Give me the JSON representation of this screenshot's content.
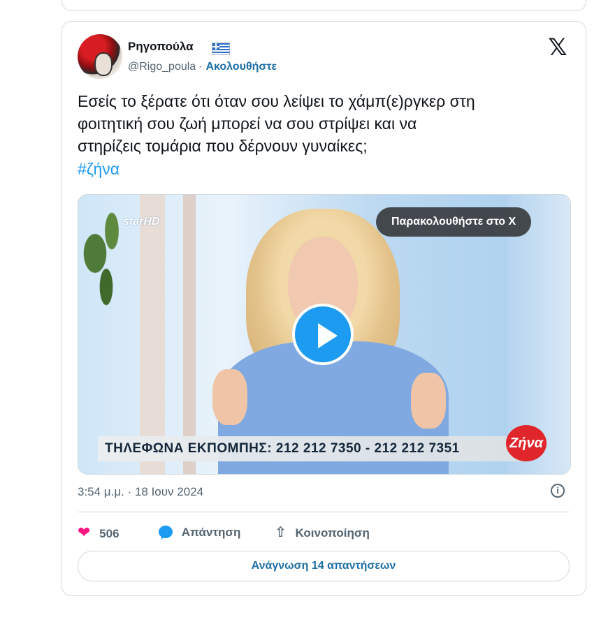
{
  "tweet": {
    "author_name": "Ρηγοπούλα",
    "author_handle": "@Rigo_poula",
    "separator": "·",
    "follow_label": "Ακολουθήστε",
    "text": "Εσείς το ξέρατε ότι όταν σου λείψει το χάμπ(ε)ργκερ στη\nφοιτητική σου ζωή μπορεί να σου στρίψει και να\nστηρίζεις τομάρια που δέρνουν γυναίκες;",
    "hashtag": "#ζήνα",
    "timestamp": "3:54 μ.μ. · 18 Ιουν 2024"
  },
  "video": {
    "channel_logo": "starHD",
    "watch_label": "Παρακολουθήστε στο X",
    "ticker_text": "ΤΗΛΕΦΩΝΑ ΕΚΠΟΜΠΗΣ: 212  212  7350 - 212  212  7351",
    "show_logo": "Ζήνα"
  },
  "actions": {
    "like_count": "506",
    "reply_label": "Απάντηση",
    "share_label": "Κοινοποίηση",
    "read_replies_label": "Ανάγνωση 14 απαντήσεων"
  },
  "icons": {
    "x_logo": "𝕏",
    "heart": "❤",
    "share": "⇧",
    "info": "i"
  },
  "colors": {
    "accent": "#1d9bf0",
    "like": "#f91880",
    "link": "#1d6fa5"
  }
}
